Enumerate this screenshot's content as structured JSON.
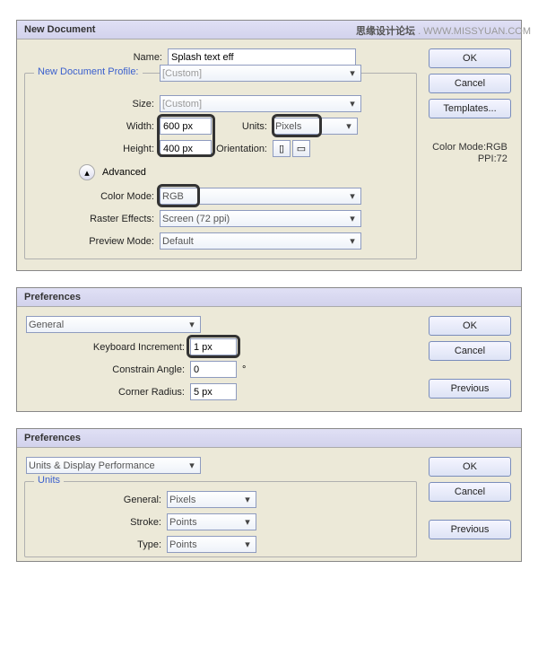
{
  "watermark": {
    "cn": "思缘设计论坛",
    "en": " . WWW.MISSYUAN.COM"
  },
  "dialog1": {
    "title": "New Document",
    "group_label": "New Document Profile:",
    "name_label": "Name:",
    "name_value": "Splash text eff",
    "profile_value": "[Custom]",
    "size_label": "Size:",
    "size_value": "[Custom]",
    "width_label": "Width:",
    "width_value": "600 px",
    "units_label": "Units:",
    "units_value": "Pixels",
    "height_label": "Height:",
    "height_value": "400 px",
    "orient_label": "Orientation:",
    "advanced_label": "Advanced",
    "color_label": "Color Mode:",
    "color_value": "RGB",
    "raster_label": "Raster Effects:",
    "raster_value": "Screen (72 ppi)",
    "preview_label": "Preview Mode:",
    "preview_value": "Default",
    "ok": "OK",
    "cancel": "Cancel",
    "templates": "Templates...",
    "info1": "Color Mode:RGB",
    "info2": "PPI:72"
  },
  "dialog2": {
    "title": "Preferences",
    "section": "General",
    "kbd_label": "Keyboard Increment:",
    "kbd_value": "1 px",
    "angle_label": "Constrain Angle:",
    "angle_value": "0",
    "angle_unit": "°",
    "radius_label": "Corner Radius:",
    "radius_value": "5 px",
    "ok": "OK",
    "cancel": "Cancel",
    "previous": "Previous"
  },
  "dialog3": {
    "title": "Preferences",
    "section": "Units & Display Performance",
    "units_group": "Units",
    "general_label": "General:",
    "general_value": "Pixels",
    "stroke_label": "Stroke:",
    "stroke_value": "Points",
    "type_label": "Type:",
    "type_value": "Points",
    "ok": "OK",
    "cancel": "Cancel",
    "previous": "Previous"
  }
}
